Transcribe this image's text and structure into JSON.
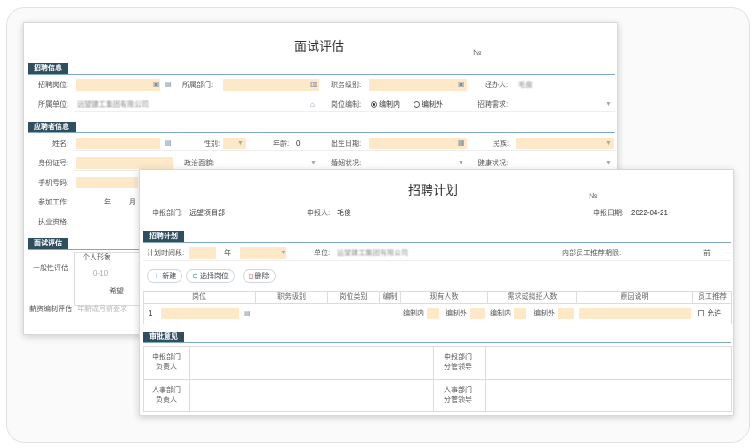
{
  "interview": {
    "title": "面试评估",
    "no": "№",
    "sec_recruit": "招聘信息",
    "sec_applicant": "应聘者信息",
    "sec_eval": "面试评估",
    "position_label": "招聘岗位:",
    "dept_label": "所属部门:",
    "grade_label": "职务级别:",
    "handler_label": "经办人:",
    "handler_value": "毛俊",
    "unit_label": "所属单位:",
    "unit_value": "远望建工集团有限公司",
    "staff_label": "岗位编制:",
    "staff_in": "编制内",
    "staff_out": "编制外",
    "need_label": "招聘需求:",
    "name_label": "姓名:",
    "gender_label": "性别:",
    "age_label": "年龄:",
    "age_value": "0",
    "birth_label": "出生日期:",
    "ethnic_label": "民族:",
    "id_label": "身份证号:",
    "political_label": "政治面貌:",
    "marital_label": "婚姻状况:",
    "health_label": "健康状况:",
    "phone_label": "手机号码:",
    "work_label": "参加工作:",
    "year": "年",
    "month": "月",
    "qual_label": "执业资格:",
    "general_label": "一般性评估",
    "personal_image": "个人形象",
    "score_range": "0-10",
    "hope_label": "希望",
    "salary_label": "薪资编制评估",
    "salary_placeholder": "年薪或月薪要求"
  },
  "plan": {
    "title": "招聘计划",
    "no": "№",
    "dept_label": "申报部门:",
    "dept_value": "远望项目部",
    "applicant_label": "申报人:",
    "applicant_value": "毛俊",
    "date_label": "申报日期:",
    "date_value": "2022-04-21",
    "sec_plan": "招聘计划",
    "period_label": "计划时间段:",
    "year": "年",
    "unit_label": "单位:",
    "unit_value": "远望建工集团有限公司",
    "internal_label": "内部员工推荐期限:",
    "before": "前",
    "btn_new": "新建",
    "btn_select": "选择岗位",
    "btn_delete": "删除",
    "columns": [
      "岗位",
      "职务级别",
      "岗位类别",
      "编制",
      "现有人数",
      "需求或拟招人数",
      "原因说明",
      "员工推荐"
    ],
    "row_index": "1",
    "in_label": "编制内",
    "out_label": "编制外",
    "allow": "允许",
    "sec_approval": "审批意见",
    "approve1": "申报部门\n负责人",
    "approve2": "申报部门\n分管领导",
    "approve3": "人事部门\n负责人",
    "approve4": "人事部门\n分管领导"
  },
  "colors": {
    "section_bg": "#2f4f5f",
    "field_bg": "#fde8c8",
    "accent_line": "#7fa7bd"
  },
  "icons": [
    "calendar-icon",
    "list-icon",
    "bank-icon",
    "dropdown-icon",
    "plus-icon",
    "search-icon",
    "delete-icon"
  ]
}
